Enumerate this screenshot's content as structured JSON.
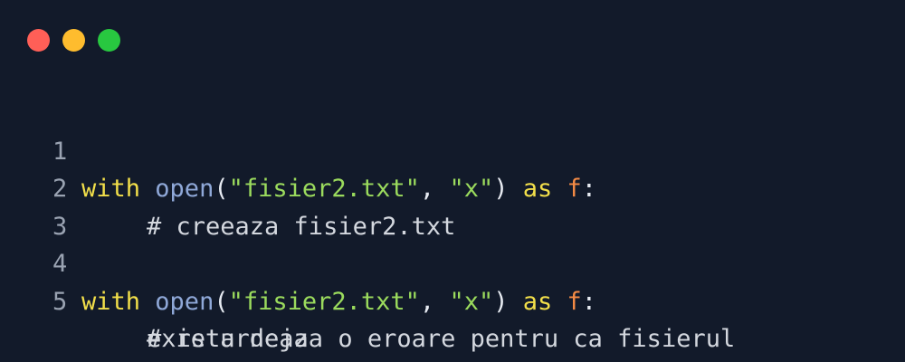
{
  "window": {
    "controls": [
      {
        "name": "close",
        "color": "#ff5f57"
      },
      {
        "name": "minimize",
        "color": "#febc2e"
      },
      {
        "name": "zoom",
        "color": "#28c840"
      }
    ]
  },
  "code": {
    "lines": [
      {
        "number": "1",
        "tokens": [
          "with",
          " ",
          "open",
          "(",
          "\"fisier2.txt\"",
          ", ",
          "\"x\"",
          ")",
          " as ",
          "f",
          ":"
        ]
      },
      {
        "number": "2",
        "comment": "# creeaza fisier2.txt"
      },
      {
        "number": "3"
      },
      {
        "number": "4",
        "tokens": [
          "with",
          " ",
          "open",
          "(",
          "\"fisier2.txt\"",
          ", ",
          "\"x\"",
          ")",
          " as ",
          "f",
          ":"
        ]
      },
      {
        "number": "5",
        "comment": "# returneaza o eroare pentru ca fisierul",
        "continuation": "exista deja"
      }
    ]
  }
}
